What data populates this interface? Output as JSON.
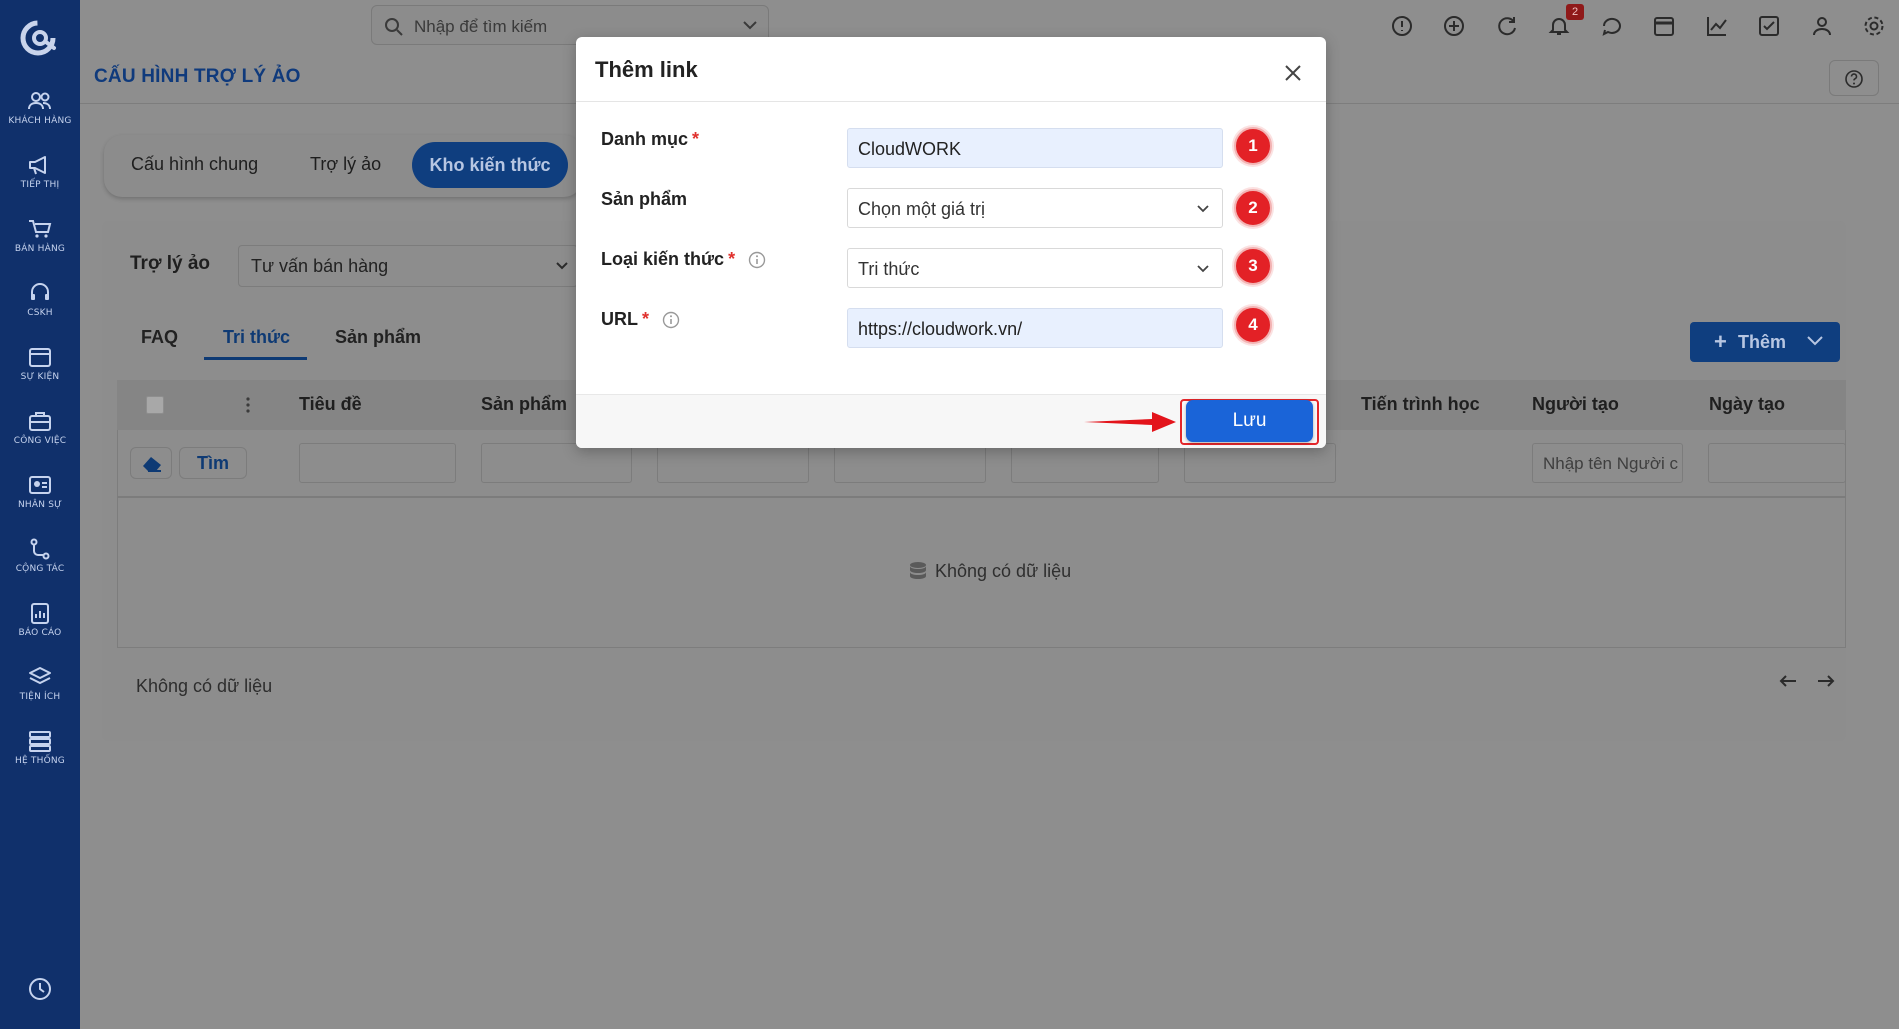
{
  "sidebar": {
    "items": [
      {
        "label": "KHÁCH HÀNG",
        "icon": "users-icon"
      },
      {
        "label": "TIẾP THỊ",
        "icon": "megaphone-icon"
      },
      {
        "label": "BÁN HÀNG",
        "icon": "cart-icon"
      },
      {
        "label": "CSKH",
        "icon": "headset-icon"
      },
      {
        "label": "SỰ KIỆN",
        "icon": "calendar-icon"
      },
      {
        "label": "CÔNG VIỆC",
        "icon": "briefcase-icon"
      },
      {
        "label": "NHÂN SỰ",
        "icon": "id-card-icon"
      },
      {
        "label": "CỘNG TÁC",
        "icon": "share-icon"
      },
      {
        "label": "BÁO CÁO",
        "icon": "report-icon"
      },
      {
        "label": "TIỆN ÍCH",
        "icon": "layers-icon"
      },
      {
        "label": "HỆ THỐNG",
        "icon": "server-icon"
      }
    ]
  },
  "topbar": {
    "search_placeholder": "Nhập để tìm kiếm",
    "notification_count": "2"
  },
  "page": {
    "title": "CẤU HÌNH TRỢ LÝ ẢO",
    "tabs": [
      "Cấu hình chung",
      "Trợ lý ảo",
      "Kho kiến thức"
    ],
    "active_tab": "Kho kiến thức"
  },
  "main": {
    "assistant_label": "Trợ lý ảo",
    "assistant_value": "Tư vấn bán hàng",
    "subtabs": [
      "FAQ",
      "Tri thức",
      "Sản phẩm"
    ],
    "add_button": "Thêm",
    "columns": [
      "Tiêu đề",
      "Sản phẩm",
      "Tiến trình học",
      "Người tạo",
      "Ngày tạo"
    ],
    "search_button": "Tìm",
    "creator_placeholder": "Nhập tên Người c",
    "empty_text": "Không có dữ liệu",
    "footer_text": "Không có dữ liệu"
  },
  "modal": {
    "title": "Thêm link",
    "fields": [
      {
        "label": "Danh mục",
        "required": true,
        "value": "CloudWORK",
        "step": "1"
      },
      {
        "label": "Sản phẩm",
        "required": false,
        "value": "Chọn một giá trị",
        "step": "2"
      },
      {
        "label": "Loại kiến thức",
        "required": true,
        "value": "Tri thức",
        "step": "3"
      },
      {
        "label": "URL",
        "required": true,
        "value": "https://cloudwork.vn/",
        "step": "4"
      }
    ],
    "save_button": "Lưu"
  },
  "colors": {
    "sidebar": "#10306b",
    "primary": "#1a64d8",
    "annotation_red": "#e32126"
  }
}
